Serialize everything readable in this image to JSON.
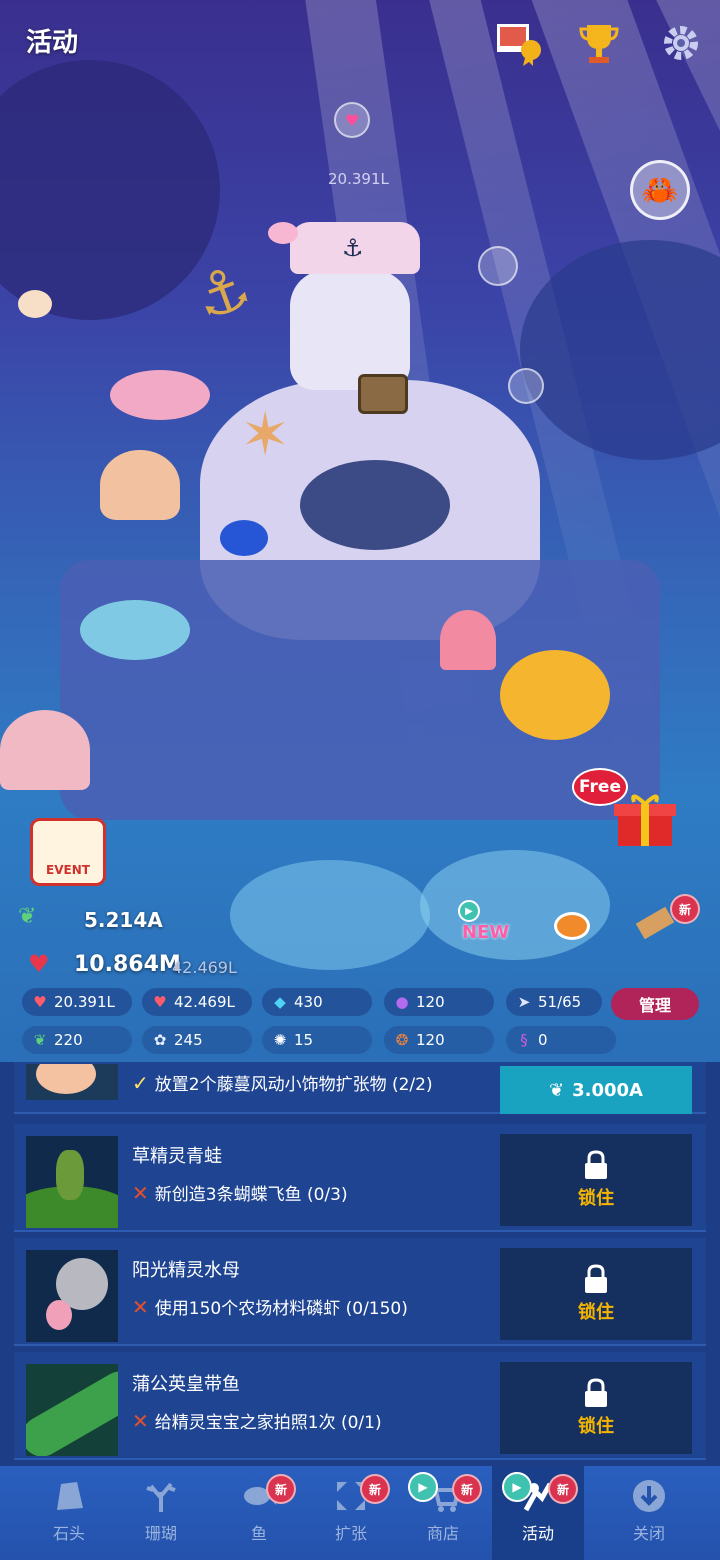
{
  "header": {
    "title": "活动"
  },
  "scene": {
    "floating_value": "20.391L",
    "free_label": "Free",
    "event_label": "EVENT",
    "new_label": "NEW",
    "new_badge": "新"
  },
  "stats": {
    "plant_value": "5.214A",
    "heart_value": "10.864M",
    "heart_rate": "42.469L",
    "chips_row1": [
      {
        "icon": "tap-heart-icon",
        "value": "20.391L"
      },
      {
        "icon": "heart-rate-icon",
        "value": "42.469L"
      },
      {
        "icon": "diamond-icon",
        "value": "430"
      },
      {
        "icon": "pearl-icon",
        "value": "120"
      },
      {
        "icon": "fish-icon",
        "value": "51/65"
      }
    ],
    "manage_label": "管理",
    "chips_row2": [
      {
        "icon": "leaf-icon",
        "value": "220"
      },
      {
        "icon": "coral-icon",
        "value": "245"
      },
      {
        "icon": "urchin-icon",
        "value": "15"
      },
      {
        "icon": "shrimp-icon",
        "value": "120"
      },
      {
        "icon": "seahorse-icon",
        "value": "0"
      }
    ]
  },
  "quests": [
    {
      "name": "",
      "task": "放置2个藤蔓风动小饰物扩张物 (2/2)",
      "status": "done",
      "price": "3.000A"
    },
    {
      "name": "草精灵青蛙",
      "task": "新创造3条蝴蝶飞鱼 (0/3)",
      "status": "locked",
      "lock_label": "锁住"
    },
    {
      "name": "阳光精灵水母",
      "task": "使用150个农场材料磷虾 (0/150)",
      "status": "locked",
      "lock_label": "锁住"
    },
    {
      "name": "蒲公英皇带鱼",
      "task": "给精灵宝宝之家拍照1次 (0/1)",
      "status": "locked",
      "lock_label": "锁住"
    }
  ],
  "nav": {
    "tabs": [
      {
        "label": "石头",
        "icon": "rock-icon"
      },
      {
        "label": "珊瑚",
        "icon": "coral-icon"
      },
      {
        "label": "鱼",
        "icon": "fish-icon",
        "badge": "新"
      },
      {
        "label": "扩张",
        "icon": "expand-icon",
        "badge": "新"
      },
      {
        "label": "商店",
        "icon": "shop-icon",
        "badge": "新"
      },
      {
        "label": "活动",
        "icon": "event-icon",
        "badge": "新",
        "active": true
      },
      {
        "label": "关闭",
        "icon": "close-down-icon"
      }
    ]
  },
  "colors": {
    "accent_teal": "#1aa3c0",
    "manage_pink": "#b0245a",
    "lock_gold": "#f4b400",
    "badge_red": "#d9334f"
  }
}
